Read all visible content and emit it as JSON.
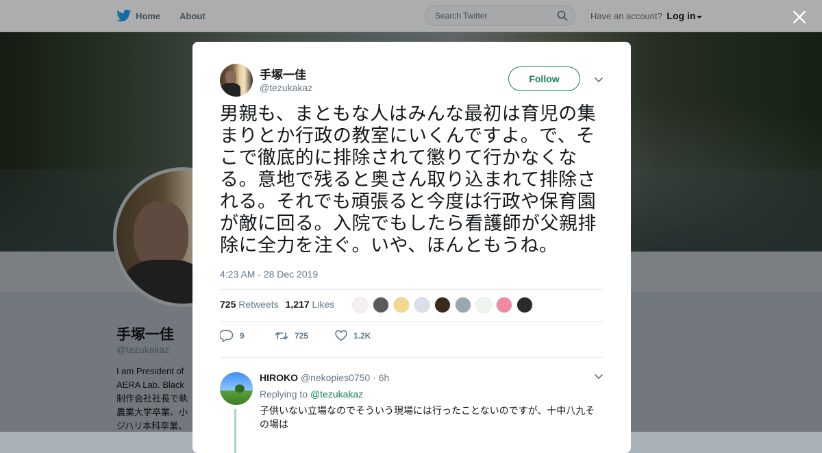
{
  "nav": {
    "home_label": "Home",
    "about_label": "About",
    "search_placeholder": "Search Twitter",
    "account_prompt": "Have an account?",
    "login_label": "Log in"
  },
  "background_profile": {
    "name": "手塚一佳",
    "handle": "@tezukakaz",
    "bio_lines": [
      "I am President of",
      "AERA Lab. Black",
      "制作会社社長で執",
      "農業大学卒業、小",
      "ジハリ本科卒業、"
    ]
  },
  "tweet": {
    "author_name": "手塚一佳",
    "author_handle": "@tezukakaz",
    "follow_label": "Follow",
    "text": "男親も、まともな人はみんな最初は育児の集まりとか行政の教室にいくんですよ。で、そこで徹底的に排除されて懲りて行かなくなる。意地で残ると奥さん取り込まれて排除される。それでも頑張ると今度は行政や保育園が敵に回る。入院でもしたら看護師が父親排除に全力を注ぐ。いや、ほんともうね。",
    "timestamp": "4:23 AM - 28 Dec 2019",
    "retweets_count": "725",
    "retweets_label": "Retweets",
    "likes_count": "1,217",
    "likes_label": "Likes",
    "liker_colors": [
      "#f4eef0",
      "#5a5a5a",
      "#f2d88a",
      "#d9dfe8",
      "#3b2a1a",
      "#9aa6b2",
      "#eef4ee",
      "#f08aa0",
      "#2a2a2a"
    ],
    "actions": {
      "reply_count": "9",
      "retweet_count": "725",
      "like_count": "1.2K"
    }
  },
  "reply": {
    "author_name": "HIROKO",
    "author_handle": "@nekopies0750",
    "age": "· 6h",
    "replying_prefix": "Replying to",
    "replying_to": "@tezukakaz",
    "text": "子供いない立場なのでそういう現場には行ったことないのですが、十中八九その場は"
  },
  "colors": {
    "accent": "#17805a",
    "twitter_blue": "#1da1f2",
    "muted_text": "#657786"
  }
}
